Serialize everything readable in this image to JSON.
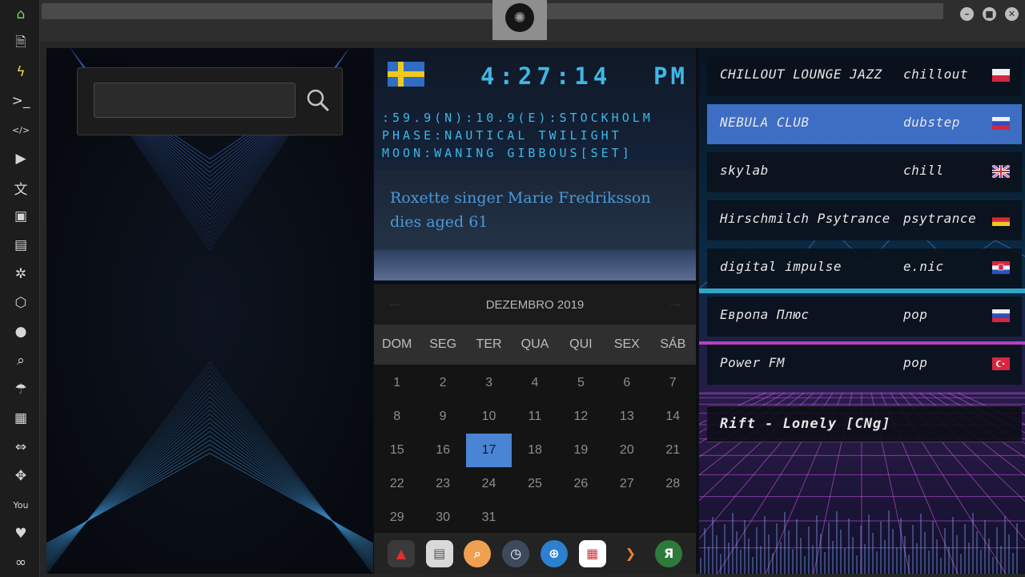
{
  "sidebar": {
    "items": [
      {
        "name": "home-icon",
        "glyph": "⌂",
        "color": "#7ed957"
      },
      {
        "name": "document-icon",
        "glyph": "🗎",
        "color": "#d6d6d6"
      },
      {
        "name": "lightning-icon",
        "glyph": "ϟ",
        "color": "#f2d94b"
      },
      {
        "name": "terminal-icon",
        "glyph": ">_",
        "color": "#d6d6d6"
      },
      {
        "name": "code-icon",
        "glyph": "</>",
        "color": "#d6d6d6"
      },
      {
        "name": "play-icon",
        "glyph": "▶",
        "color": "#d6d6d6"
      },
      {
        "name": "translate-icon",
        "glyph": "文",
        "color": "#d6d6d6"
      },
      {
        "name": "image-icon",
        "glyph": "▣",
        "color": "#d6d6d6"
      },
      {
        "name": "news-icon",
        "glyph": "▤",
        "color": "#d6d6d6"
      },
      {
        "name": "empire-icon",
        "glyph": "✲",
        "color": "#d6d6d6"
      },
      {
        "name": "hexagon-icon",
        "glyph": "⬡",
        "color": "#d6d6d6"
      },
      {
        "name": "globe-icon",
        "glyph": "●",
        "color": "#d6d6d6"
      },
      {
        "name": "search-icon",
        "glyph": "⌕",
        "color": "#d6d6d6"
      },
      {
        "name": "umbrella-icon",
        "glyph": "☂",
        "color": "#d6d6d6"
      },
      {
        "name": "contacts-icon",
        "glyph": "▦",
        "color": "#d6d6d6"
      },
      {
        "name": "link-icon",
        "glyph": "⇔",
        "color": "#d6d6d6"
      },
      {
        "name": "expand-icon",
        "glyph": "✥",
        "color": "#d6d6d6"
      },
      {
        "name": "youtube-icon",
        "glyph": "You",
        "color": "#d6d6d6"
      },
      {
        "name": "heart-icon",
        "glyph": "♥",
        "color": "#d6d6d6"
      },
      {
        "name": "infinity-icon",
        "glyph": "∞",
        "color": "#d6d6d6"
      }
    ]
  },
  "window": {
    "logo_icon": "rebel-alliance-icon",
    "minimize": "–",
    "maximize": "■",
    "close": "✕"
  },
  "search": {
    "value": "",
    "icon": "search-icon"
  },
  "clock": {
    "flag": "sweden-flag",
    "time": "4:27:14",
    "ampm": "PM",
    "line1": ":59.9(N):10.9(E):STOCKHOLM",
    "line2": "PHASE:NAUTICAL TWILIGHT",
    "line3": "MOON:WANING GIBBOUS[SET]"
  },
  "news": {
    "headline": "Roxette singer Marie Fredriksson dies aged 61"
  },
  "calendar": {
    "prev": "←",
    "next": "→",
    "month": "DEZEMBRO 2019",
    "dows": [
      "DOM",
      "SEG",
      "TER",
      "QUA",
      "QUI",
      "SEX",
      "SÁB"
    ],
    "weeks": [
      [
        "1",
        "2",
        "3",
        "4",
        "5",
        "6",
        "7"
      ],
      [
        "8",
        "9",
        "10",
        "11",
        "12",
        "13",
        "14"
      ],
      [
        "15",
        "16",
        "17",
        "18",
        "19",
        "20",
        "21"
      ],
      [
        "22",
        "23",
        "24",
        "25",
        "26",
        "27",
        "28"
      ],
      [
        "29",
        "30",
        "31",
        "",
        "",
        "",
        ""
      ]
    ],
    "today": "17"
  },
  "dock": {
    "apps": [
      {
        "name": "red-triangle-app-icon",
        "glyph": "▲",
        "color": "#3a3a3a",
        "fg": "#e03030"
      },
      {
        "name": "news-reader-app-icon",
        "glyph": "▤",
        "color": "#d9d9d9",
        "fg": "#555"
      },
      {
        "name": "search-app-icon",
        "glyph": "⌕",
        "color": "#f0a050",
        "fg": "#ffffff"
      },
      {
        "name": "clock-app-icon",
        "glyph": "◷",
        "color": "#3d4a5c",
        "fg": "#ffffff"
      },
      {
        "name": "globe-app-icon",
        "glyph": "⊕",
        "color": "#2d7fd0",
        "fg": "#ffffff"
      },
      {
        "name": "calendar-app-icon",
        "glyph": "▦",
        "color": "#ffffff",
        "fg": "#e03030"
      },
      {
        "name": "arrow-app-icon",
        "glyph": "❯",
        "color": "#232323",
        "fg": "#f08030"
      },
      {
        "name": "yandex-app-icon",
        "glyph": "Я",
        "color": "#2e7a3a",
        "fg": "#ffffff"
      }
    ]
  },
  "radio": {
    "stations": [
      {
        "name": "CHILLOUT LOUNGE JAZZ",
        "genre": "chillout",
        "flag": "poland-flag",
        "active": false
      },
      {
        "name": "NEBULA CLUB",
        "genre": "dubstep",
        "flag": "russia-flag",
        "active": true
      },
      {
        "name": "skylab",
        "genre": "chill",
        "flag": "uk-flag",
        "active": false
      },
      {
        "name": "Hirschmilch Psytrance",
        "genre": "psytrance",
        "flag": "germany-flag",
        "active": false
      },
      {
        "name": "digital impulse",
        "genre": "e.nic",
        "flag": "croatia-flag",
        "active": false
      },
      {
        "name": "Европа Плюс",
        "genre": "pop",
        "flag": "russia-flag",
        "active": false
      },
      {
        "name": "Power FM",
        "genre": "pop",
        "flag": "turkey-flag",
        "active": false
      }
    ],
    "now_playing": "Rift - Lonely [CNg]"
  }
}
